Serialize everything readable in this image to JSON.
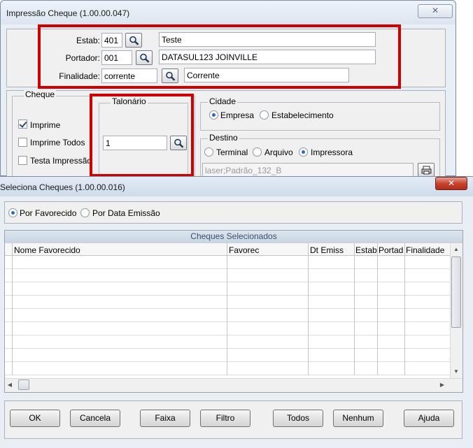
{
  "window1": {
    "title": "Impressão Cheque (1.00.00.047)",
    "close_glyph": "✕",
    "estab": {
      "label": "Estab:",
      "value": "401",
      "desc": "Teste"
    },
    "portador": {
      "label": "Portador:",
      "value": "001",
      "desc": "DATASUL123 JOINVILLE"
    },
    "finalidade": {
      "label": "Finalidade:",
      "value": "corrente",
      "desc": "Corrente"
    },
    "cheque": {
      "title": "Cheque",
      "imprime": {
        "label": "Imprime",
        "checked": true
      },
      "imprime_todos": {
        "label": "Imprime Todos",
        "checked": false
      },
      "testa_impressao": {
        "label": "Testa Impressão",
        "checked": false
      }
    },
    "talonario": {
      "title": "Talonário",
      "value": "1"
    },
    "cidade": {
      "title": "Cidade",
      "options": [
        {
          "label": "Empresa",
          "selected": true
        },
        {
          "label": "Estabelecimento",
          "selected": false
        }
      ]
    },
    "destino": {
      "title": "Destino",
      "options": [
        {
          "label": "Terminal",
          "selected": false
        },
        {
          "label": "Arquivo",
          "selected": false
        },
        {
          "label": "Impressora",
          "selected": true
        }
      ],
      "printer": "laser;Padrão_132_B"
    }
  },
  "window2": {
    "title": "Seleciona Cheques (1.00.00.016)",
    "close_glyph": "✕",
    "sort_options": [
      {
        "label": "Por Favorecido",
        "selected": true
      },
      {
        "label": "Por Data Emissão",
        "selected": false
      }
    ],
    "grid": {
      "title": "Cheques Selecionados",
      "columns": [
        "Nome Favorecido",
        "Favorec",
        "Dt Emiss",
        "Estab",
        "Portad",
        "Finalidade"
      ],
      "rows": 9
    },
    "buttons": {
      "ok": "OK",
      "cancela": "Cancela",
      "faixa": "Faixa",
      "filtro": "Filtro",
      "todos": "Todos",
      "nenhum": "Nenhum",
      "ajuda": "Ajuda"
    }
  },
  "colors": {
    "highlight_red": "#d10000",
    "accent_blue": "#2f6bc6"
  },
  "icons": {
    "lookup": "magnifier-icon",
    "close": "close-icon",
    "printer": "printer-icon"
  }
}
